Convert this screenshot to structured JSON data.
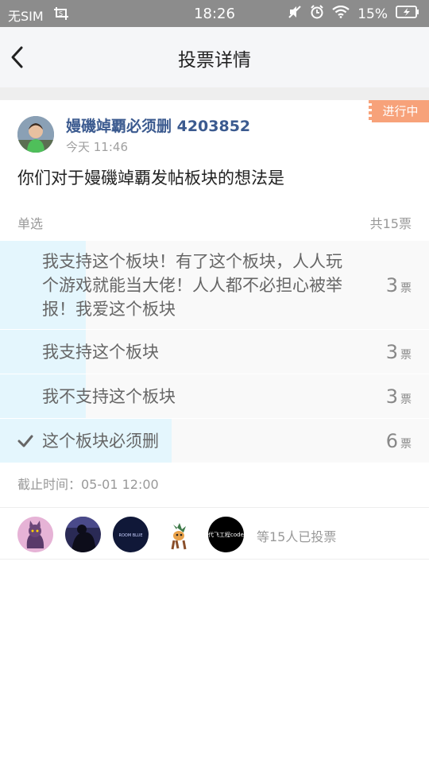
{
  "status_bar": {
    "carrier": "无SIM",
    "time": "18:26",
    "battery": "15%"
  },
  "nav": {
    "title": "投票详情"
  },
  "post": {
    "status_tag": "进行中",
    "author": "嫚磯竨覇必须删 4203852",
    "time": "今天 11:46",
    "question": "你们对于嫚磯竨覇发帖板块的想法是",
    "vote_type": "单选",
    "total_votes": "共15票",
    "deadline": "截止时间：05-01 12:00"
  },
  "options": [
    {
      "text": "我支持这个板块！有了这个板块，人人玩个游戏就能当大佬！人人都不必担心被举报！我爱这个板块",
      "count": "3",
      "unit": "票",
      "fraction": 0.2,
      "selected": false
    },
    {
      "text": "我支持这个板块",
      "count": "3",
      "unit": "票",
      "fraction": 0.2,
      "selected": false
    },
    {
      "text": "我不支持这个板块",
      "count": "3",
      "unit": "票",
      "fraction": 0.2,
      "selected": false
    },
    {
      "text": "这个板块必须删",
      "count": "6",
      "unit": "票",
      "fraction": 0.4,
      "selected": true
    }
  ],
  "voters": {
    "summary": "等15人已投票",
    "avatar_labels": [
      "",
      "",
      "ROOM BLUE",
      "",
      "代飞工程code"
    ]
  },
  "colors": {
    "accent_tag": "#f7a27a",
    "author_blue": "#3b5a8f",
    "bar_fill": "#e4f6fd",
    "status_bar": "#8c8c8c"
  }
}
